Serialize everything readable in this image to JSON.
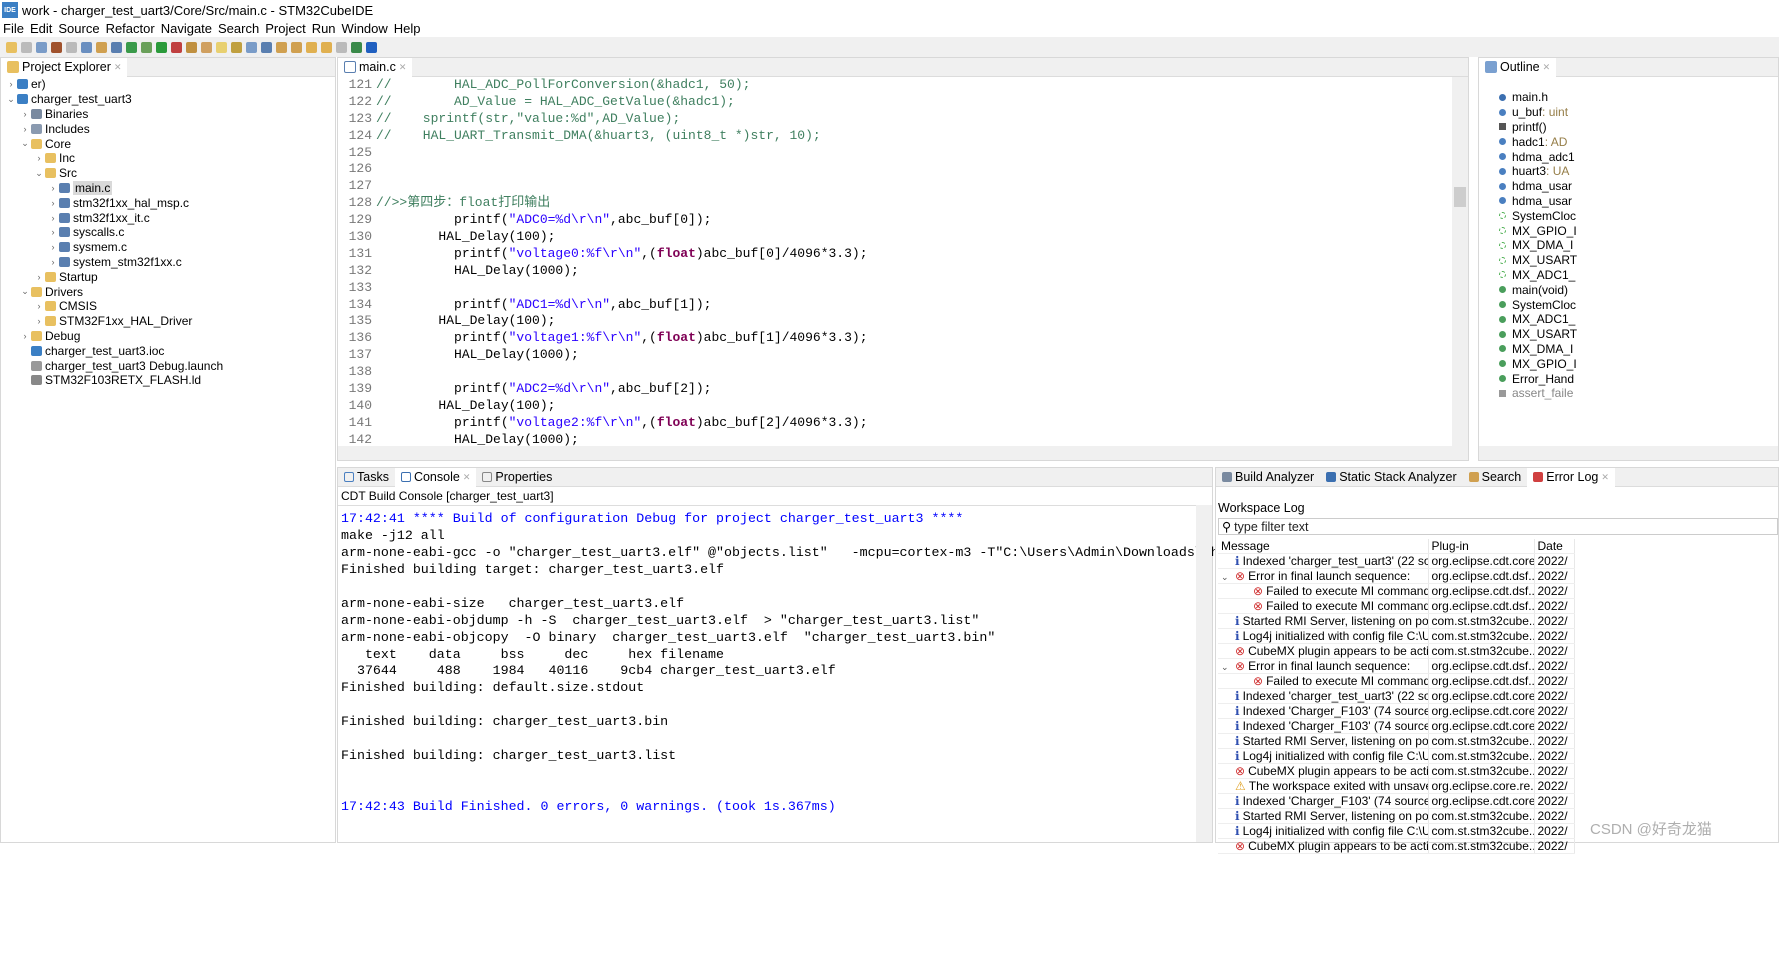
{
  "window": {
    "title": "work - charger_test_uart3/Core/Src/main.c - STM32CubeIDE",
    "logo": "IDE"
  },
  "menu": [
    "File",
    "Edit",
    "Source",
    "Refactor",
    "Navigate",
    "Search",
    "Project",
    "Run",
    "Window",
    "Help"
  ],
  "project_explorer": {
    "title": "Project Explorer",
    "items": [
      {
        "label": "er)",
        "depth": 0,
        "arrow": ">",
        "icon": "project"
      },
      {
        "label": "charger_test_uart3",
        "depth": 0,
        "arrow": "v",
        "icon": "project"
      },
      {
        "label": "Binaries",
        "depth": 1,
        "arrow": ">",
        "icon": "binaries"
      },
      {
        "label": "Includes",
        "depth": 1,
        "arrow": ">",
        "icon": "includes"
      },
      {
        "label": "Core",
        "depth": 1,
        "arrow": "v",
        "icon": "folder"
      },
      {
        "label": "Inc",
        "depth": 2,
        "arrow": ">",
        "icon": "folder"
      },
      {
        "label": "Src",
        "depth": 2,
        "arrow": "v",
        "icon": "folder"
      },
      {
        "label": "main.c",
        "depth": 3,
        "arrow": ">",
        "icon": "c-file",
        "selected": true
      },
      {
        "label": "stm32f1xx_hal_msp.c",
        "depth": 3,
        "arrow": ">",
        "icon": "c-file"
      },
      {
        "label": "stm32f1xx_it.c",
        "depth": 3,
        "arrow": ">",
        "icon": "c-file"
      },
      {
        "label": "syscalls.c",
        "depth": 3,
        "arrow": ">",
        "icon": "c-file"
      },
      {
        "label": "sysmem.c",
        "depth": 3,
        "arrow": ">",
        "icon": "c-file"
      },
      {
        "label": "system_stm32f1xx.c",
        "depth": 3,
        "arrow": ">",
        "icon": "c-file"
      },
      {
        "label": "Startup",
        "depth": 2,
        "arrow": ">",
        "icon": "folder"
      },
      {
        "label": "Drivers",
        "depth": 1,
        "arrow": "v",
        "icon": "folder"
      },
      {
        "label": "CMSIS",
        "depth": 2,
        "arrow": ">",
        "icon": "folder"
      },
      {
        "label": "STM32F1xx_HAL_Driver",
        "depth": 2,
        "arrow": ">",
        "icon": "folder"
      },
      {
        "label": "Debug",
        "depth": 1,
        "arrow": ">",
        "icon": "folder"
      },
      {
        "label": "charger_test_uart3.ioc",
        "depth": 1,
        "arrow": "",
        "icon": "ioc-file"
      },
      {
        "label": "charger_test_uart3 Debug.launch",
        "depth": 1,
        "arrow": "",
        "icon": "launch-file"
      },
      {
        "label": "STM32F103RETX_FLASH.ld",
        "depth": 1,
        "arrow": "",
        "icon": "ld-file"
      }
    ]
  },
  "editor": {
    "tab": "main.c",
    "lines": [
      {
        "n": "121",
        "seg": [
          [
            "com",
            "//        HAL_ADC_PollForConversion(&hadc1, 50);"
          ]
        ]
      },
      {
        "n": "122",
        "seg": [
          [
            "com",
            "//        AD_Value = HAL_ADC_GetValue(&hadc1);"
          ]
        ]
      },
      {
        "n": "123",
        "seg": [
          [
            "com",
            "//    sprintf(str,\"value:%d\",AD_Value);"
          ]
        ]
      },
      {
        "n": "124",
        "seg": [
          [
            "com",
            "//    HAL_UART_Transmit_DMA(&huart3, (uint8_t *)str, 10);"
          ]
        ]
      },
      {
        "n": "125",
        "seg": []
      },
      {
        "n": "126",
        "seg": []
      },
      {
        "n": "127",
        "seg": []
      },
      {
        "n": "128",
        "seg": [
          [
            "com",
            "//>>第四步：float打印输出"
          ]
        ]
      },
      {
        "n": "129",
        "seg": [
          [
            "txt",
            "          printf("
          ],
          [
            "str",
            "\"ADC0=%d\\r\\n\""
          ],
          [
            "txt",
            ",abc_buf[0]);"
          ]
        ]
      },
      {
        "n": "130",
        "seg": [
          [
            "txt",
            "        HAL_Delay(100);"
          ]
        ]
      },
      {
        "n": "131",
        "seg": [
          [
            "txt",
            "          printf("
          ],
          [
            "str",
            "\"voltage0:%f\\r\\n\""
          ],
          [
            "txt",
            ",("
          ],
          [
            "kw",
            "float"
          ],
          [
            "txt",
            ")abc_buf[0]/4096*3.3);"
          ]
        ]
      },
      {
        "n": "132",
        "seg": [
          [
            "txt",
            "          HAL_Delay(1000);"
          ]
        ]
      },
      {
        "n": "133",
        "seg": []
      },
      {
        "n": "134",
        "seg": [
          [
            "txt",
            "          printf("
          ],
          [
            "str",
            "\"ADC1=%d\\r\\n\""
          ],
          [
            "txt",
            ",abc_buf[1]);"
          ]
        ]
      },
      {
        "n": "135",
        "seg": [
          [
            "txt",
            "        HAL_Delay(100);"
          ]
        ]
      },
      {
        "n": "136",
        "seg": [
          [
            "txt",
            "          printf("
          ],
          [
            "str",
            "\"voltage1:%f\\r\\n\""
          ],
          [
            "txt",
            ",("
          ],
          [
            "kw",
            "float"
          ],
          [
            "txt",
            ")abc_buf[1]/4096*3.3);"
          ]
        ]
      },
      {
        "n": "137",
        "seg": [
          [
            "txt",
            "          HAL_Delay(1000);"
          ]
        ]
      },
      {
        "n": "138",
        "seg": []
      },
      {
        "n": "139",
        "seg": [
          [
            "txt",
            "          printf("
          ],
          [
            "str",
            "\"ADC2=%d\\r\\n\""
          ],
          [
            "txt",
            ",abc_buf[2]);"
          ]
        ]
      },
      {
        "n": "140",
        "seg": [
          [
            "txt",
            "        HAL_Delay(100);"
          ]
        ]
      },
      {
        "n": "141",
        "seg": [
          [
            "txt",
            "          printf("
          ],
          [
            "str",
            "\"voltage2:%f\\r\\n\""
          ],
          [
            "txt",
            ",("
          ],
          [
            "kw",
            "float"
          ],
          [
            "txt",
            ")abc_buf[2]/4096*3.3);"
          ]
        ]
      },
      {
        "n": "142",
        "seg": [
          [
            "txt",
            "          HAL_Delay(1000);"
          ]
        ]
      }
    ]
  },
  "outline": {
    "title": "Outline",
    "items": [
      {
        "label": "main.h",
        "icon": "include",
        "color": "#3b6fb0"
      },
      {
        "label": "u_buf",
        "type": " : uint",
        "icon": "variable",
        "color": "#4a7fc0"
      },
      {
        "label": "printf()",
        "icon": "macro",
        "color": "#555555"
      },
      {
        "label": "hadc1",
        "type": " : AD",
        "icon": "variable",
        "color": "#4a7fc0"
      },
      {
        "label": "hdma_adc1",
        "icon": "variable",
        "color": "#4a7fc0"
      },
      {
        "label": "huart3",
        "type": " : UA",
        "icon": "variable",
        "color": "#4a7fc0"
      },
      {
        "label": "hdma_usar",
        "icon": "variable",
        "color": "#4a7fc0"
      },
      {
        "label": "hdma_usar",
        "icon": "variable",
        "color": "#4a7fc0"
      },
      {
        "label": "SystemCloc",
        "icon": "function-declaration",
        "color": "#4caf50"
      },
      {
        "label": "MX_GPIO_I",
        "icon": "static-function-declaration",
        "color": "#4caf50"
      },
      {
        "label": "MX_DMA_I",
        "icon": "static-function-declaration",
        "color": "#4caf50"
      },
      {
        "label": "MX_USART",
        "icon": "static-function-declaration",
        "color": "#4caf50"
      },
      {
        "label": "MX_ADC1_",
        "icon": "static-function-declaration",
        "color": "#4caf50"
      },
      {
        "label": "main(void)",
        "icon": "function",
        "color": "#4a9e5c"
      },
      {
        "label": "SystemCloc",
        "icon": "function",
        "color": "#4a9e5c"
      },
      {
        "label": "MX_ADC1_",
        "icon": "static-function",
        "color": "#4a9e5c"
      },
      {
        "label": "MX_USART",
        "icon": "static-function",
        "color": "#4a9e5c"
      },
      {
        "label": "MX_DMA_I",
        "icon": "static-function",
        "color": "#4a9e5c"
      },
      {
        "label": "MX_GPIO_I",
        "icon": "static-function",
        "color": "#4a9e5c"
      },
      {
        "label": "Error_Hand",
        "icon": "function",
        "color": "#4a9e5c"
      },
      {
        "label": "assert_faile",
        "icon": "macro-disabled",
        "color": "#999999"
      }
    ]
  },
  "bottom_tabs": [
    "Tasks",
    "Console",
    "Properties"
  ],
  "console": {
    "header": "CDT Build Console [charger_test_uart3]",
    "lines": [
      {
        "t": "17:42:41 **** Build of configuration Debug for project charger_test_uart3 ****",
        "blue": true
      },
      {
        "t": "make -j12 all"
      },
      {
        "t": "arm-none-eabi-gcc -o \"charger_test_uart3.elf\" @\"objects.list\"   -mcpu=cortex-m3 -T\"C:\\Users\\Admin\\Downloads\\cha"
      },
      {
        "t": "Finished building target: charger_test_uart3.elf"
      },
      {
        "t": " "
      },
      {
        "t": "arm-none-eabi-size   charger_test_uart3.elf"
      },
      {
        "t": "arm-none-eabi-objdump -h -S  charger_test_uart3.elf  > \"charger_test_uart3.list\""
      },
      {
        "t": "arm-none-eabi-objcopy  -O binary  charger_test_uart3.elf  \"charger_test_uart3.bin\""
      },
      {
        "t": "   text    data     bss     dec     hex filename"
      },
      {
        "t": "  37644     488    1984   40116    9cb4 charger_test_uart3.elf"
      },
      {
        "t": "Finished building: default.size.stdout"
      },
      {
        "t": " "
      },
      {
        "t": "Finished building: charger_test_uart3.bin"
      },
      {
        "t": " "
      },
      {
        "t": "Finished building: charger_test_uart3.list"
      },
      {
        "t": " "
      },
      {
        "t": " "
      },
      {
        "t": "17:42:43 Build Finished. 0 errors, 0 warnings. (took 1s.367ms)",
        "blue": true
      }
    ]
  },
  "right_tabs": [
    "Build Analyzer",
    "Static Stack Analyzer",
    "Search",
    "Error Log"
  ],
  "error_log": {
    "title": "Workspace Log",
    "filter_placeholder": "type filter text",
    "columns": [
      "Message",
      "Plug-in",
      "Date"
    ],
    "rows": [
      {
        "icon": "info",
        "m": "Indexed 'charger_test_uart3' (22 sou",
        "p": "org.eclipse.cdt.core",
        "d": "2022/"
      },
      {
        "icon": "error-group",
        "exp": true,
        "m": "Error in final launch sequence:",
        "p": "org.eclipse.cdt.dsf....",
        "d": "2022/"
      },
      {
        "icon": "error-child",
        "child": true,
        "m": "Failed to execute MI command:",
        "p": "org.eclipse.cdt.dsf....",
        "d": "2022/"
      },
      {
        "icon": "error-child",
        "child": true,
        "m": "Failed to execute MI command:",
        "p": "org.eclipse.cdt.dsf....",
        "d": "2022/"
      },
      {
        "icon": "info",
        "m": "Started RMI Server, listening on port",
        "p": "com.st.stm32cube....",
        "d": "2022/"
      },
      {
        "icon": "info",
        "m": "Log4j initialized with config file C:\\U:",
        "p": "com.st.stm32cube....",
        "d": "2022/"
      },
      {
        "icon": "error",
        "m": "CubeMX plugin appears to be active",
        "p": "com.st.stm32cube....",
        "d": "2022/"
      },
      {
        "icon": "error-group",
        "exp": true,
        "m": "Error in final launch sequence:",
        "p": "org.eclipse.cdt.dsf....",
        "d": "2022/"
      },
      {
        "icon": "error-child",
        "child": true,
        "m": "Failed to execute MI command:",
        "p": "org.eclipse.cdt.dsf....",
        "d": "2022/"
      },
      {
        "icon": "info",
        "m": "Indexed 'charger_test_uart3' (22 sou",
        "p": "org.eclipse.cdt.core",
        "d": "2022/"
      },
      {
        "icon": "info",
        "m": "Indexed 'Charger_F103' (74 sources,",
        "p": "org.eclipse.cdt.core",
        "d": "2022/"
      },
      {
        "icon": "info",
        "m": "Indexed 'Charger_F103' (74 sources,",
        "p": "org.eclipse.cdt.core",
        "d": "2022/"
      },
      {
        "icon": "info",
        "m": "Started RMI Server, listening on port",
        "p": "com.st.stm32cube....",
        "d": "2022/"
      },
      {
        "icon": "info",
        "m": "Log4j initialized with config file C:\\U:",
        "p": "com.st.stm32cube....",
        "d": "2022/"
      },
      {
        "icon": "error",
        "m": "CubeMX plugin appears to be active",
        "p": "com.st.stm32cube....",
        "d": "2022/"
      },
      {
        "icon": "warning",
        "m": "The workspace exited with unsaved",
        "p": "org.eclipse.core.re...",
        "d": "2022/"
      },
      {
        "icon": "info",
        "m": "Indexed 'Charger_F103' (74 sources,",
        "p": "org.eclipse.cdt.core",
        "d": "2022/"
      },
      {
        "icon": "info",
        "m": "Started RMI Server, listening on port",
        "p": "com.st.stm32cube....",
        "d": "2022/"
      },
      {
        "icon": "info",
        "m": "Log4j initialized with config file C:\\U:",
        "p": "com.st.stm32cube....",
        "d": "2022/"
      },
      {
        "icon": "error",
        "m": "CubeMX plugin appears to be active",
        "p": "com.st.stm32cube....",
        "d": "2022/"
      }
    ]
  },
  "watermark": "CSDN @好奇龙猫"
}
